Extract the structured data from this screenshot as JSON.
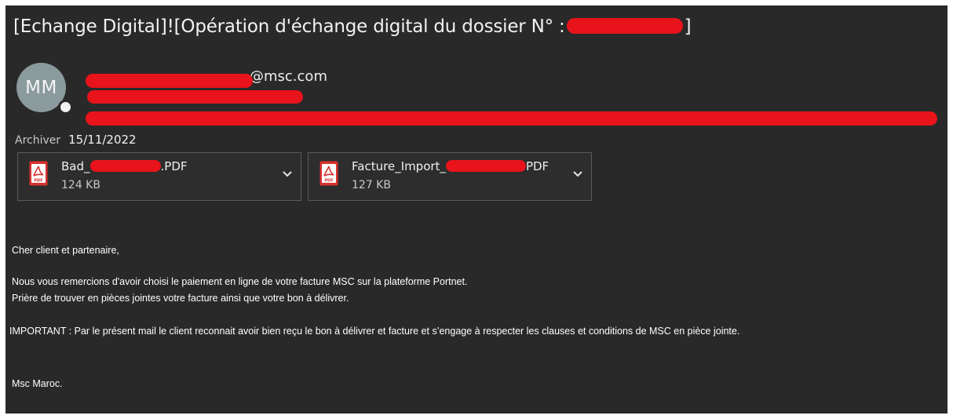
{
  "subject": {
    "prefix": "[Echange Digital]![Opération d'échange digital du dossier N° :",
    "suffix": "]"
  },
  "sender": {
    "avatar_initials": "MM",
    "email_domain": "@msc.com"
  },
  "meta": {
    "archive_label": "Archiver",
    "date": "15/11/2022"
  },
  "attachments": [
    {
      "name_prefix": "Bad_",
      "name_suffix": ".PDF",
      "size": "124 KB",
      "icon": "pdf-icon"
    },
    {
      "name_prefix": "Facture_Import_",
      "name_suffix": "PDF",
      "size": "127 KB",
      "icon": "pdf-icon"
    }
  ],
  "body": {
    "greeting": "Cher client et partenaire,",
    "line1": "Nous vous remercions d'avoir choisi le paiement en ligne de votre facture MSC sur la plateforme Portnet.",
    "line2": "Prière de trouver en pièces jointes votre facture ainsi que votre bon à délivrer.",
    "important": "IMPORTANT : Par le présent mail le client reconnait avoir bien reçu le bon à délivrer et facture et s’engage à respecter les clauses et conditions de MSC en pièce jointe.",
    "signature": "Msc Maroc."
  },
  "colors": {
    "background": "#292929",
    "redaction": "#e8131b",
    "avatar": "#8b9a9c",
    "pdf_red": "#d9322e"
  }
}
